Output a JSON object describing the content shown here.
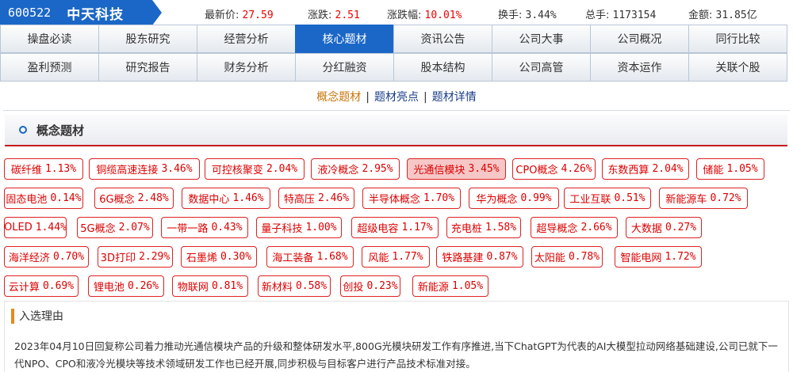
{
  "stock": {
    "code": "600522",
    "name": "中天科技"
  },
  "quote": {
    "last_label": "最新价:",
    "last_value": "27.59",
    "chg_label": "涨跌:",
    "chg_value": "2.51",
    "chgpct_label": "涨跌幅:",
    "chgpct_value": "10.01%",
    "turnover_label": "换手:",
    "turnover_value": "3.44%",
    "vol_label": "总手:",
    "vol_value": "1173154",
    "amount_label": "金额:",
    "amount_value": "31.85亿"
  },
  "nav": {
    "row1": [
      "操盘必读",
      "股东研究",
      "经营分析",
      "核心题材",
      "资讯公告",
      "公司大事",
      "公司概况",
      "同行比较"
    ],
    "row2": [
      "盈利预测",
      "研究报告",
      "财务分析",
      "分红融资",
      "股本结构",
      "公司高管",
      "资本运作",
      "关联个股"
    ],
    "active": "核心题材"
  },
  "subtabs": [
    "概念题材",
    "题材亮点",
    "题材详情"
  ],
  "section": {
    "title": "概念题材"
  },
  "tags": [
    [
      {
        "name": "碳纤维",
        "pct": "1.13%"
      },
      {
        "name": "铜缆高速连接",
        "pct": "3.46%"
      },
      {
        "name": "可控核聚变",
        "pct": "2.04%"
      },
      {
        "name": "液冷概念",
        "pct": "2.95%"
      },
      {
        "name": "光通信模块",
        "pct": "3.45%"
      },
      {
        "name": "CPO概念",
        "pct": "4.26%"
      },
      {
        "name": "东数西算",
        "pct": "2.04%"
      },
      {
        "name": "储能",
        "pct": "1.05%"
      }
    ],
    [
      {
        "name": "固态电池",
        "pct": "0.14%"
      },
      {
        "name": "6G概念",
        "pct": "2.48%"
      },
      {
        "name": "数据中心",
        "pct": "1.46%"
      },
      {
        "name": "特高压",
        "pct": "2.46%"
      },
      {
        "name": "半导体概念",
        "pct": "1.70%"
      },
      {
        "name": "华为概念",
        "pct": "0.99%"
      },
      {
        "name": "工业互联",
        "pct": "0.51%"
      },
      {
        "name": "新能源车",
        "pct": "0.72%"
      }
    ],
    [
      {
        "name": "OLED",
        "pct": "1.44%"
      },
      {
        "name": "5G概念",
        "pct": "2.07%"
      },
      {
        "name": "一带一路",
        "pct": "0.43%"
      },
      {
        "name": "量子科技",
        "pct": "1.00%"
      },
      {
        "name": "超级电容",
        "pct": "1.17%"
      },
      {
        "name": "充电桩",
        "pct": "1.58%"
      },
      {
        "name": "超导概念",
        "pct": "2.66%"
      },
      {
        "name": "大数据",
        "pct": "0.27%"
      }
    ],
    [
      {
        "name": "海洋经济",
        "pct": "0.70%"
      },
      {
        "name": "3D打印",
        "pct": "2.29%"
      },
      {
        "name": "石墨烯",
        "pct": "0.30%"
      },
      {
        "name": "海工装备",
        "pct": "1.68%"
      },
      {
        "name": "风能",
        "pct": "1.77%"
      },
      {
        "name": "铁路基建",
        "pct": "0.87%"
      },
      {
        "name": "太阳能",
        "pct": "0.78%"
      },
      {
        "name": "智能电网",
        "pct": "1.72%"
      }
    ],
    [
      {
        "name": "云计算",
        "pct": "0.69%"
      },
      {
        "name": "锂电池",
        "pct": "0.26%"
      },
      {
        "name": "物联网",
        "pct": "0.81%"
      },
      {
        "name": "新材料",
        "pct": "0.58%"
      },
      {
        "name": "创投",
        "pct": "0.23%"
      },
      {
        "name": "新能源",
        "pct": "1.05%"
      }
    ]
  ],
  "highlighted_tag": "光通信模块",
  "reason": {
    "title": "入选理由",
    "text": "2023年04月10日回复称公司着力推动光通信模块产品的升级和整体研发水平,800G光模块研发工作有序推进,当下ChatGPT为代表的AI大模型拉动网络基础建设,公司已就下一代NPO、CPO和液冷光模块等技术领域研发工作也已经开展,同步积极与目标客户进行产品技术标准对接。"
  },
  "colors": {
    "accent_blue": "#1b67c7",
    "tag_red": "#dd0000",
    "highlight_bg": "#f7c7c7",
    "orange": "#e8891c"
  }
}
